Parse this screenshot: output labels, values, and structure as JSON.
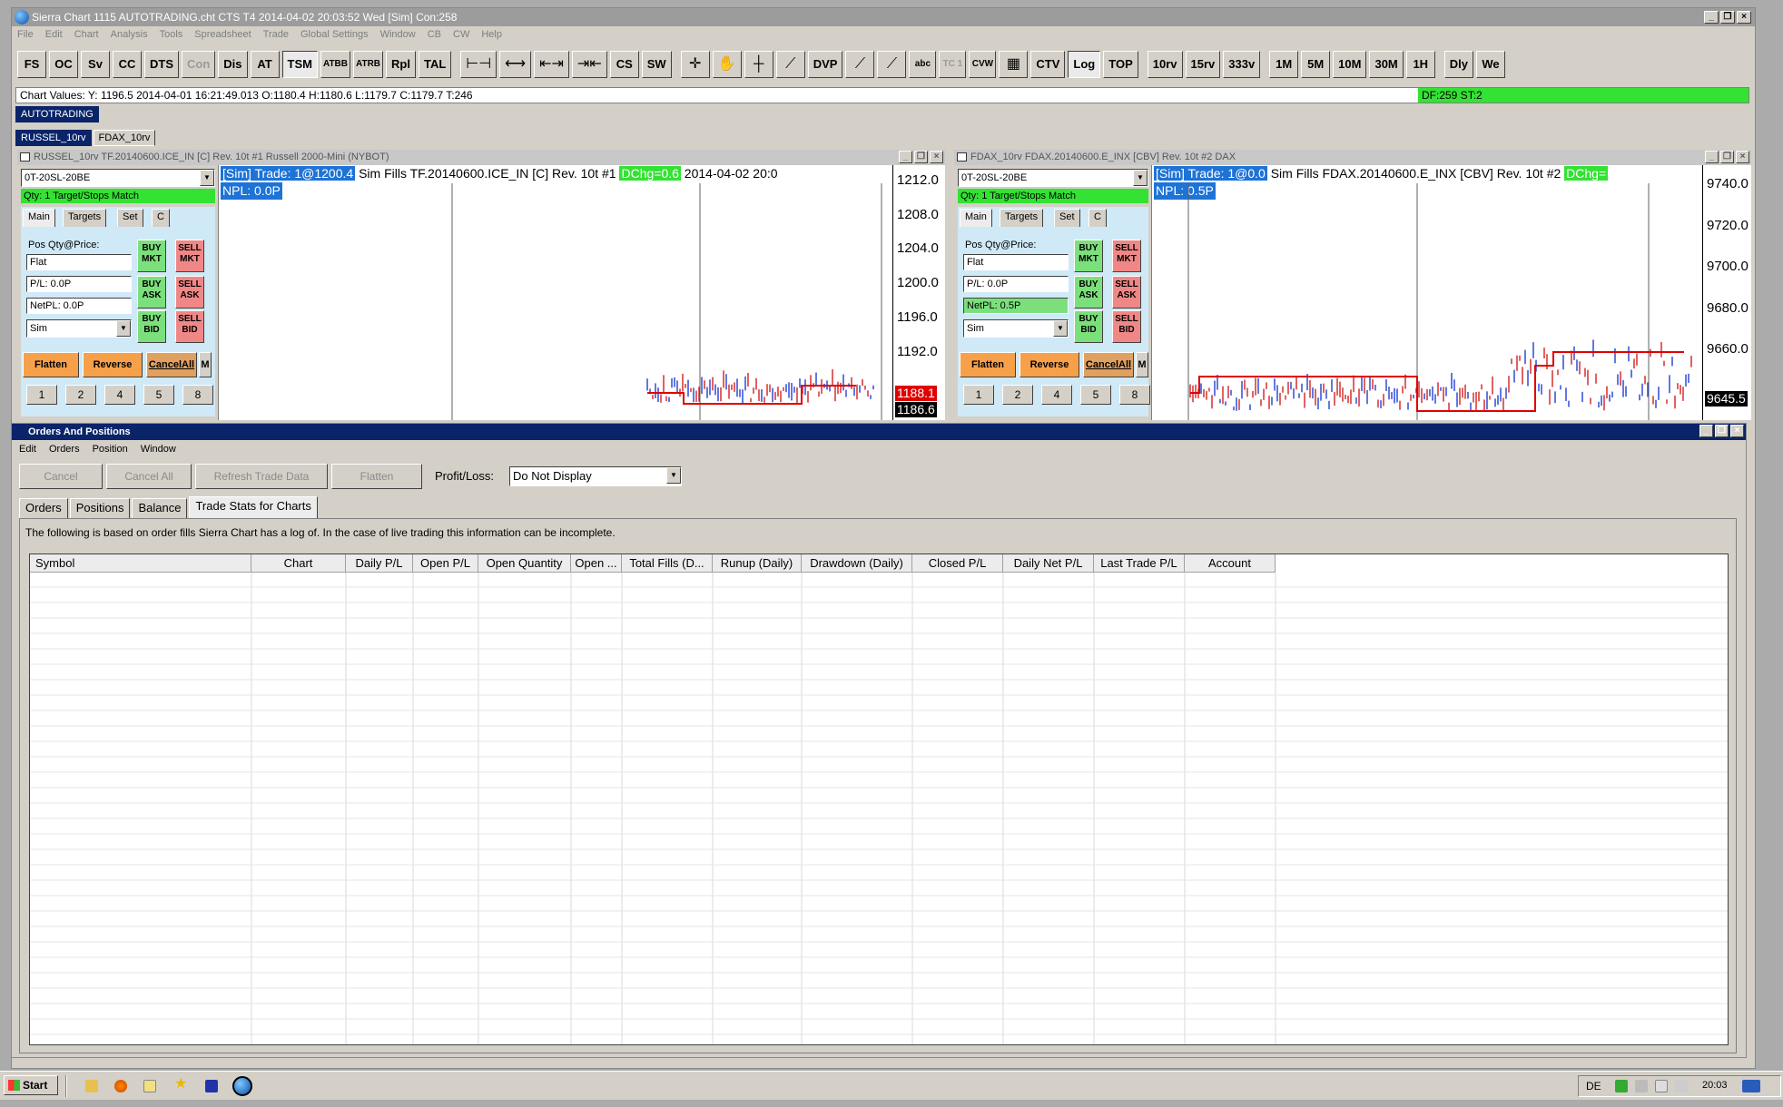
{
  "app": {
    "title": "Sierra Chart 1115 AUTOTRADING.cht  CTS T4 2014-04-02  20:03:52 Wed [Sim]  Con:258",
    "menu": [
      "File",
      "Edit",
      "Chart",
      "Analysis",
      "Tools",
      "Spreadsheet",
      "Trade",
      "Global Settings",
      "Window",
      "CB",
      "CW",
      "Help"
    ],
    "toolbar": [
      "FS",
      "OC",
      "Sv",
      "CC",
      "DTS",
      "Con",
      "Dis",
      "AT",
      "TSM",
      "ATBB",
      "ATRB",
      "Rpl",
      "TAL"
    ],
    "toolbar_misc": [
      "CS",
      "SW",
      "DVP",
      "abc",
      "TC 1",
      "CVW",
      "CTV",
      "Log",
      "TOP",
      "10rv",
      "15rv",
      "333v",
      "1M",
      "5M",
      "10M",
      "30M",
      "1H",
      "Dly",
      "We"
    ],
    "toolbar_icons": [
      "range-icon",
      "range-expand-icon",
      "bar-spacing-decrease-icon",
      "bar-spacing-increase-icon",
      "crosshair-icon",
      "hand-icon",
      "cursor-icon",
      "drawing-icon",
      "line-icon",
      "ray-icon",
      "table-icon"
    ],
    "chart_values": "Chart Values:  Y: 1196.5  2014-04-01  16:21:49.013  O:1180.4  H:1180.6  L:1179.7  C:1179.7  T:246",
    "df_st": "DF:259  ST:2",
    "chartbook_tab": "AUTOTRADING",
    "chart_tabs": [
      "RUSSEL_10rv",
      "FDAX_10rv"
    ]
  },
  "charts": [
    {
      "title": "RUSSEL_10rv  TF.20140600.ICE_IN [C]  Rev. 10t  #1  Russell 2000-Mini (NYBOT)",
      "strategy": "0T-20SL-20BE",
      "qty_status": "Qty: 1 Target/Stops Match",
      "tabs": [
        "Main",
        "Targets",
        "Set",
        "C"
      ],
      "pos_label": "Pos Qty@Price:",
      "pos_value": "Flat",
      "pl": "P/L: 0.0P",
      "netpl": "NetPL: 0.0P",
      "netpl_green": false,
      "account": "Sim",
      "buttons": {
        "buy_mkt": [
          "BUY",
          "MKT"
        ],
        "sell_mkt": [
          "SELL",
          "MKT"
        ],
        "buy_ask": [
          "BUY",
          "ASK"
        ],
        "sell_ask": [
          "SELL",
          "ASK"
        ],
        "buy_bid": [
          "BUY",
          "BID"
        ],
        "sell_bid": [
          "SELL",
          "BID"
        ]
      },
      "flatten": "Flatten",
      "reverse": "Reverse",
      "cancelall": "CancelAll",
      "m": "M",
      "qty_buttons": [
        "1",
        "2",
        "4",
        "5",
        "8"
      ],
      "header_seg1": "[Sim]  Trade: 1@1200.4",
      "header_seg2": " Sim Fills  TF.20140600.ICE_IN [C]  Rev. 10t  #1 ",
      "header_seg3": "DChg=0.6",
      "header_seg4": " 2014-04-02  20:0",
      "npl": "NPL: 0.0P",
      "axis": [
        "1212.0",
        "1208.0",
        "1204.0",
        "1200.0",
        "1196.0",
        "1192.0"
      ],
      "price_current": "1188.1",
      "price_current_color": "#e00000",
      "price_last": "1186.6",
      "price_last_color": "#000000"
    },
    {
      "title": "FDAX_10rv  FDAX.20140600.E_INX [CBV]  Rev. 10t  #2  DAX",
      "strategy": "0T-20SL-20BE",
      "qty_status": "Qty: 1 Target/Stops Match",
      "tabs": [
        "Main",
        "Targets",
        "Set",
        "C"
      ],
      "pos_label": "Pos Qty@Price:",
      "pos_value": "Flat",
      "pl": "P/L: 0.0P",
      "netpl": "NetPL: 0.5P",
      "netpl_green": true,
      "account": "Sim",
      "buttons": {
        "buy_mkt": [
          "BUY",
          "MKT"
        ],
        "sell_mkt": [
          "SELL",
          "MKT"
        ],
        "buy_ask": [
          "BUY",
          "ASK"
        ],
        "sell_ask": [
          "SELL",
          "ASK"
        ],
        "buy_bid": [
          "BUY",
          "BID"
        ],
        "sell_bid": [
          "SELL",
          "BID"
        ]
      },
      "flatten": "Flatten",
      "reverse": "Reverse",
      "cancelall": "CancelAll",
      "m": "M",
      "qty_buttons": [
        "1",
        "2",
        "4",
        "5",
        "8"
      ],
      "header_seg1": "[Sim]  Trade: 1@0.0",
      "header_seg2": " Sim Fills  FDAX.20140600.E_INX [CBV]  Rev. 10t  #2 ",
      "header_seg3": "DChg=",
      "header_seg4": "",
      "npl": "NPL: 0.5P",
      "axis": [
        "9740.0",
        "9720.0",
        "9700.0",
        "9680.0",
        "9660.0"
      ],
      "price_current": "9645.5",
      "price_current_color": "#000000",
      "price_last": "",
      "price_last_color": "#1e73d6"
    }
  ],
  "orders_window": {
    "title": "Orders And Positions",
    "menu": [
      "Edit",
      "Orders",
      "Position",
      "Window"
    ],
    "buttons": [
      "Cancel",
      "Cancel All",
      "Refresh Trade Data",
      "Flatten"
    ],
    "profit_label": "Profit/Loss:",
    "profit_value": "Do Not Display",
    "tabs": [
      "Orders",
      "Positions",
      "Balance",
      "Trade Stats for Charts"
    ],
    "active_tab": 3,
    "note": "The following is based on order fills Sierra Chart has a log of.  In the case of live trading this information can be incomplete.",
    "columns": [
      "Symbol",
      "Chart",
      "Daily P/L",
      "Open P/L",
      "Open Quantity",
      "Open ...",
      "Total Fills (D...",
      "Runup (Daily)",
      "Drawdown (Daily)",
      "Closed P/L",
      "Daily Net P/L",
      "Last Trade P/L",
      "Account"
    ]
  },
  "taskbar": {
    "start": "Start",
    "lang": "DE",
    "clock": "20:03"
  }
}
